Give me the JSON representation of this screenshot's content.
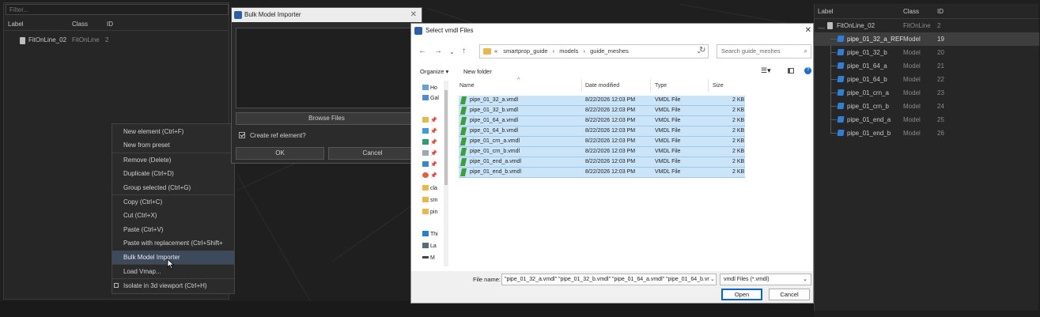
{
  "left_panel": {
    "filter_placeholder": "Filter...",
    "headers": {
      "label": "Label",
      "class": "Class",
      "id": "ID"
    },
    "rows": [
      {
        "label": "FitOnLine_02",
        "class": "FitOnLine",
        "id": "2"
      }
    ]
  },
  "context_menu": {
    "items": [
      "New element (Ctrl+F)",
      "New from preset",
      "Remove (Delete)",
      "Duplicate (Ctrl+D)",
      "Group selected (Ctrl+G)",
      "Copy (Ctrl+C)",
      "Cut (Ctrl+X)",
      "Paste (Ctrl+V)",
      "Paste with replacement (Ctrl+Shift+",
      "Bulk Model Importer",
      "Load Vmap...",
      "Isolate in 3d viewport (Ctrl+H)"
    ]
  },
  "bulk_importer": {
    "title": "Bulk Model Importer",
    "browse_label": "Browse Files",
    "create_ref_label": "Create ref element?",
    "create_ref_checked": true,
    "ok_label": "OK",
    "cancel_label": "Cancel"
  },
  "file_dialog": {
    "title": "Select vmdl Files",
    "breadcrumb": [
      "«",
      "smartprop_guide",
      "models",
      "guide_meshes"
    ],
    "search_placeholder": "Search guide_meshes",
    "organize_label": "Organize ▾",
    "new_folder_label": "New folder",
    "nav_items": [
      {
        "label": "Ho",
        "icon": "home-icon"
      },
      {
        "label": "Gal",
        "icon": "gallery-icon"
      },
      {
        "label": "",
        "icon": "folder-icon"
      },
      {
        "label": "",
        "icon": "desktop-icon"
      },
      {
        "label": "",
        "icon": "download-icon"
      },
      {
        "label": "",
        "icon": "document-icon"
      },
      {
        "label": "",
        "icon": "pictures-icon"
      },
      {
        "label": "",
        "icon": "music-icon"
      },
      {
        "label": "cla",
        "icon": "folder-icon"
      },
      {
        "label": "sm",
        "icon": "folder-icon"
      },
      {
        "label": "pin",
        "icon": "folder-icon"
      },
      {
        "label": "Thi",
        "icon": "computer-icon"
      },
      {
        "label": "La",
        "icon": "laptop-icon"
      },
      {
        "label": "M",
        "icon": "drive-icon"
      }
    ],
    "columns": [
      "Name",
      "Date modified",
      "Type",
      "Size"
    ],
    "files": [
      {
        "name": "pipe_01_32_a.vmdl",
        "date": "8/22/2026 12:03 PM",
        "type": "VMDL File",
        "size": "2 KB"
      },
      {
        "name": "pipe_01_32_b.vmdl",
        "date": "8/22/2026 12:03 PM",
        "type": "VMDL File",
        "size": "2 KB"
      },
      {
        "name": "pipe_01_64_a.vmdl",
        "date": "8/22/2026 12:03 PM",
        "type": "VMDL File",
        "size": "2 KB"
      },
      {
        "name": "pipe_01_64_b.vmdl",
        "date": "8/22/2026 12:03 PM",
        "type": "VMDL File",
        "size": "2 KB"
      },
      {
        "name": "pipe_01_crn_a.vmdl",
        "date": "8/22/2026 12:03 PM",
        "type": "VMDL File",
        "size": "2 KB"
      },
      {
        "name": "pipe_01_crn_b.vmdl",
        "date": "8/22/2026 12:03 PM",
        "type": "VMDL File",
        "size": "2 KB"
      },
      {
        "name": "pipe_01_end_a.vmdl",
        "date": "8/22/2026 12:03 PM",
        "type": "VMDL File",
        "size": "2 KB"
      },
      {
        "name": "pipe_01_end_b.vmdl",
        "date": "8/22/2026 12:03 PM",
        "type": "VMDL File",
        "size": "2 KB"
      }
    ],
    "filename_label": "File name:",
    "filename_value": "\"pipe_01_32_a.vmdl\" \"pipe_01_32_b.vmdl\" \"pipe_01_64_a.vmdl\" \"pipe_01_64_b.vr",
    "filetype_value": "vmdl Files (*.vmdl)",
    "open_label": "Open",
    "cancel_label": "Cancel"
  },
  "right_panel": {
    "headers": {
      "label": "Label",
      "class": "Class",
      "id": "ID"
    },
    "root": {
      "label": "FitOnLine_02",
      "class": "FitOnLine",
      "id": "2"
    },
    "children": [
      {
        "label": "pipe_01_32_a_REF",
        "class": "Model",
        "id": "19"
      },
      {
        "label": "pipe_01_32_b",
        "class": "Model",
        "id": "20"
      },
      {
        "label": "pipe_01_64_a",
        "class": "Model",
        "id": "21"
      },
      {
        "label": "pipe_01_64_b",
        "class": "Model",
        "id": "22"
      },
      {
        "label": "pipe_01_crn_a",
        "class": "Model",
        "id": "23"
      },
      {
        "label": "pipe_01_crn_b",
        "class": "Model",
        "id": "24"
      },
      {
        "label": "pipe_01_end_a",
        "class": "Model",
        "id": "25"
      },
      {
        "label": "pipe_01_end_b",
        "class": "Model",
        "id": "26"
      }
    ]
  },
  "colors": {
    "selection": "#cce4f7",
    "accent": "#0067c0",
    "model_icon": "#2f7fd6",
    "vmdl_icon": "#3aa13a"
  }
}
